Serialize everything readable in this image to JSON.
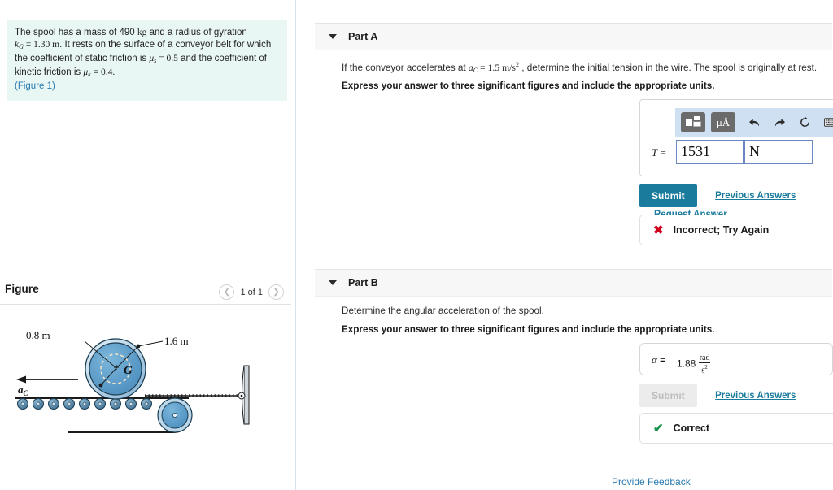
{
  "problem": {
    "line1_a": "The spool has a mass of 490 ",
    "line1_kg": "kg",
    "line1_b": " and a radius of gyration",
    "line2_k": "k",
    "line2_ksub": "G",
    "line2_eq": " = 1.30 m",
    "line2_rest": ". It rests on the surface of a conveyor belt for which",
    "line3_a": "the coefficient of static friction is ",
    "line3_mu": "μ",
    "line3_musub": "s",
    "line3_val": " = 0.5",
    "line3_b": " and the coefficient of",
    "line4_a": "kinetic friction is ",
    "line4_mu": "μ",
    "line4_musub": "k",
    "line4_val": " = 0.4.",
    "figure_link": "(Figure 1)"
  },
  "figure": {
    "title": "Figure",
    "prev_icon": "chevron-left-icon",
    "next_icon": "chevron-right-icon",
    "counter": "1 of 1",
    "labels": {
      "inner_radius": "0.8 m",
      "outer_radius": "1.6 m",
      "center": "G",
      "acceleration": "a",
      "acceleration_sub": "C"
    }
  },
  "parts": [
    {
      "id": "part-a",
      "caret_icon": "caret-down-icon",
      "label": "Part A",
      "question_pre": "If the conveyor accelerates at ",
      "question_var": "a",
      "question_varsub": "C",
      "question_val": " = 1.5 m/s",
      "question_exp": "2",
      "question_post": " , determine the initial tension in the wire. The spool is originally at rest.",
      "instruction": "Express your answer to three significant figures and include the appropriate units.",
      "toolbar": {
        "template_icon": "math-template-icon",
        "units_label": "μÅ",
        "undo_icon": "undo-arrow-icon",
        "redo_icon": "redo-arrow-icon",
        "reset_icon": "reset-circle-icon",
        "keyboard_icon": "keyboard-icon",
        "help_icon": "question-mark-icon"
      },
      "answer_label": "T",
      "answer_equals": "=",
      "answer_value": "1531",
      "answer_units": "N",
      "submit_label": "Submit",
      "submit_disabled": false,
      "links": [
        "Previous Answers",
        "Request Answer"
      ],
      "feedback_icon": "x-mark-icon",
      "feedback_mark": "✖",
      "feedback_text": "Incorrect; Try Again",
      "feedback_state": "wrong"
    },
    {
      "id": "part-b",
      "caret_icon": "caret-down-icon",
      "label": "Part B",
      "question_pre": "Determine the angular acceleration of the spool.",
      "instruction": "Express your answer to three significant figures and include the appropriate units.",
      "answer_label": "α",
      "answer_equals": "=",
      "answer_value": "1.88",
      "answer_unit_num": "rad",
      "answer_unit_den": "s",
      "answer_unit_den_exp": "2",
      "submit_label": "Submit",
      "submit_disabled": true,
      "links": [
        "Previous Answers"
      ],
      "feedback_icon": "check-mark-icon",
      "feedback_mark": "✔",
      "feedback_text": "Correct",
      "feedback_state": "right"
    }
  ],
  "footer": {
    "provide_feedback": "Provide Feedback"
  },
  "colors": {
    "accent": "#1a7b9c",
    "link": "#2a7ab0",
    "problem_bg": "#e8f6f4",
    "toolbar_bg": "#cfe0f2",
    "incorrect": "#d0021b",
    "correct": "#17924b",
    "spool_fill": "#5b9bc9",
    "spool_rim": "#b7d3e8"
  }
}
